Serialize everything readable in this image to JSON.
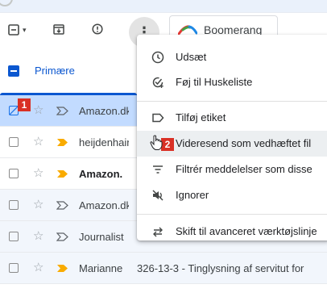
{
  "toolbar": {
    "boomerang_label": "Boomerang"
  },
  "tabs": {
    "primary_label": "Primære"
  },
  "emails": [
    {
      "sender": "Amazon.dk",
      "subject": "",
      "state": "selected",
      "starred": false,
      "important": false
    },
    {
      "sender": "heijdenhain",
      "subject": "",
      "state": "unread",
      "starred": false,
      "important": true
    },
    {
      "sender": "Amazon.",
      "subject": "",
      "state": "unread",
      "starred": false,
      "important": true
    },
    {
      "sender": "Amazon.dk",
      "subject": "",
      "state": "read",
      "starred": false,
      "important": false
    },
    {
      "sender": "Journalist",
      "subject": "",
      "state": "read",
      "starred": false,
      "important": false
    },
    {
      "sender": "Marianne",
      "subject": "326-13-3 - Tinglysning af servitut for",
      "state": "read",
      "starred": false,
      "important": true
    }
  ],
  "context_menu": {
    "items": [
      {
        "label": "Udsæt",
        "icon": "clock-icon"
      },
      {
        "label": "Føj til Huskeliste",
        "icon": "add-task-icon"
      },
      {
        "label": "Tilføj etiket",
        "icon": "label-icon"
      },
      {
        "label": "Videresend som vedhæftet fil",
        "icon": "forward-attachment-icon"
      },
      {
        "label": "Filtrér meddelelser som disse",
        "icon": "filter-icon"
      },
      {
        "label": "Ignorer",
        "icon": "mute-icon"
      },
      {
        "label": "Skift til avanceret værktøjslinje",
        "icon": "switch-icon"
      }
    ]
  },
  "annotations": {
    "badge_1": "1",
    "badge_2": "2"
  },
  "colors": {
    "accent": "#0b57d0",
    "selected_row": "#c2dbff",
    "read_row": "#f2f6fc",
    "important": "#f9ab00",
    "badge": "#d93025"
  }
}
